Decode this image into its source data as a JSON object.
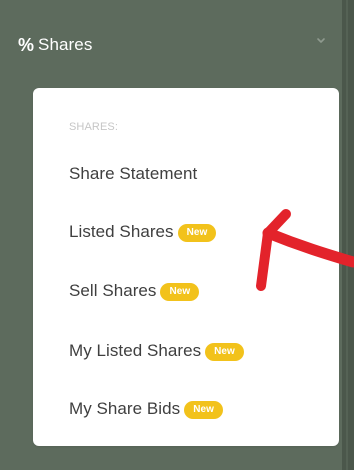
{
  "header": {
    "icon_text": "%",
    "title": "Shares"
  },
  "dropdown": {
    "section_label": "SHARES:",
    "items": [
      {
        "label": "Share Statement",
        "badge": ""
      },
      {
        "label": "Listed Shares",
        "badge": "New"
      },
      {
        "label": "Sell Shares",
        "badge": "New"
      },
      {
        "label": "My Listed Shares",
        "badge": "New"
      },
      {
        "label": "My Share Bids",
        "badge": "New"
      }
    ]
  },
  "colors": {
    "sidebar_bg": "#5d6b5d",
    "panel_bg": "#ffffff",
    "text": "#3f3f3f",
    "muted": "#c6c6c6",
    "badge": "#f2c21b",
    "annotation_arrow": "#e3232b"
  },
  "icons": {
    "header": "percent-icon",
    "chevron": "chevron-down-icon",
    "annotation": "red-arrow-annotation"
  }
}
